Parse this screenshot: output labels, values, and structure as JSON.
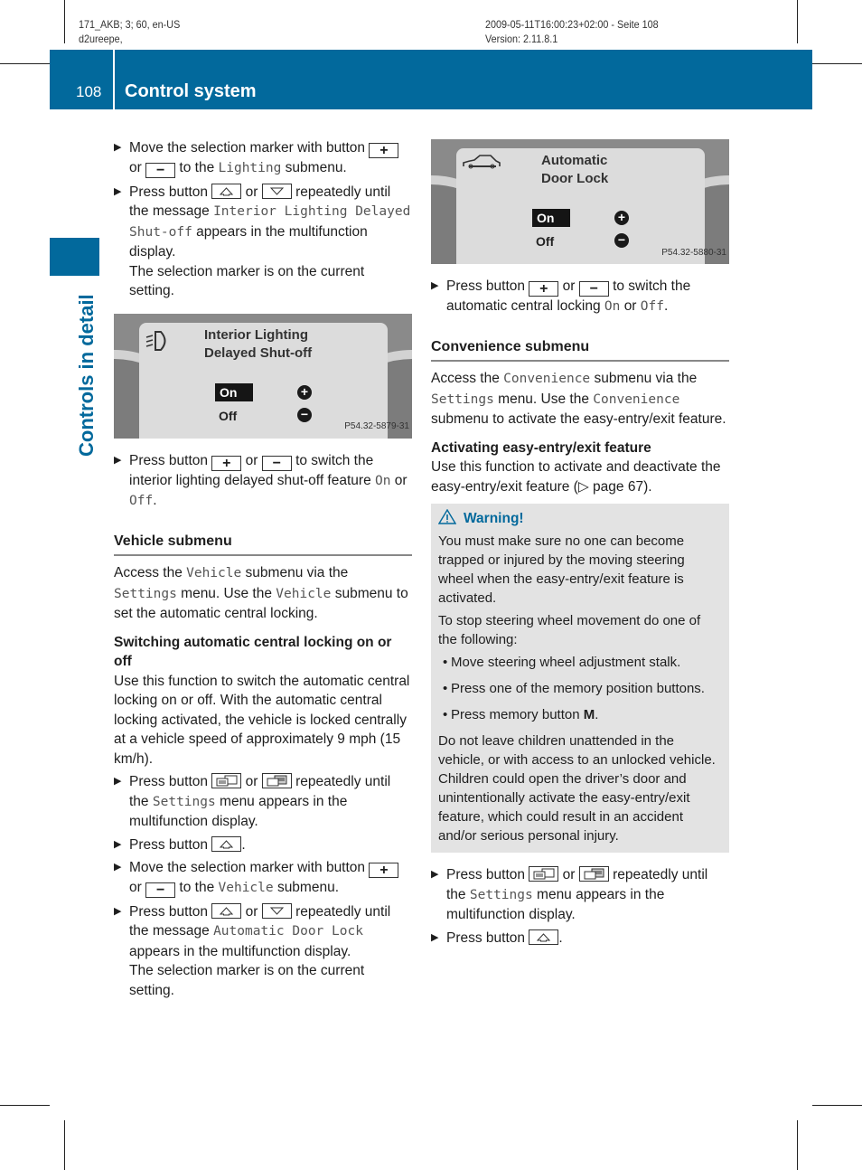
{
  "meta": {
    "top_left_line1": "171_AKB; 3; 60, en-US",
    "top_left_line2": "d2ureepe,",
    "top_right_line1": "2009-05-11T16:00:23+02:00 - Seite 108",
    "top_right_line2": "Version: 2.11.8.1"
  },
  "header": {
    "page_number": "108",
    "title": "Control system",
    "side_label": "Controls in detail",
    "accent_color": "#02699c"
  },
  "left": {
    "step1": {
      "a": "Move the selection marker with button",
      "b": "or",
      "c": "to the",
      "mono": "Lighting",
      "d": "submenu."
    },
    "step2": {
      "a": "Press button",
      "b": "or",
      "c": "repeatedly until the message",
      "mono": "Interior Lighting Delayed Shut-off",
      "d": "appears in the multifunction display.",
      "e": "The selection marker is on the current setting."
    },
    "figure1": {
      "title_line1": "Interior Lighting",
      "title_line2": "Delayed Shut-off",
      "on": "On",
      "off": "Off",
      "code": "P54.32-5879-31"
    },
    "step3": {
      "a": "Press button",
      "b": "or",
      "c": "to switch the interior lighting delayed shut-off feature",
      "on": "On",
      "or": "or",
      "off": "Off",
      "end": "."
    },
    "vehicle_heading": "Vehicle submenu",
    "vehicle_para": {
      "a": "Access the",
      "m1": "Vehicle",
      "b": "submenu via the",
      "m2": "Settings",
      "c": "menu. Use the",
      "m3": "Vehicle",
      "d": "submenu to set the automatic central locking."
    },
    "switching_heading": "Switching automatic central locking on or off",
    "switching_para": "Use this function to switch the automatic central locking on or off. With the automatic central locking activated, the vehicle is locked centrally at a vehicle speed of approximately 9 mph (15 km/h).",
    "step4": {
      "a": "Press button",
      "b": "or",
      "c": "repeatedly until the",
      "mono": "Settings",
      "d": "menu appears in the multifunction display."
    },
    "step5": {
      "a": "Press button",
      "end": "."
    },
    "step6": {
      "a": "Move the selection marker with button",
      "b": "or",
      "c": "to the",
      "mono": "Vehicle",
      "d": "submenu."
    },
    "step7": {
      "a": "Press button",
      "b": "or",
      "c": "repeatedly until the message",
      "mono": "Automatic Door Lock",
      "d": "appears in the multifunction display.",
      "e": "The selection marker is on the current setting."
    }
  },
  "right": {
    "figure2": {
      "title_line1": "Automatic",
      "title_line2": "Door Lock",
      "on": "On",
      "off": "Off",
      "code": "P54.32-5880-31"
    },
    "step1": {
      "a": "Press button",
      "b": "or",
      "c": "to switch the automatic central locking",
      "on": "On",
      "or": "or",
      "off": "Off",
      "end": "."
    },
    "convenience_heading": "Convenience submenu",
    "convenience_para": {
      "a": "Access the",
      "m1": "Convenience",
      "b": "submenu via the",
      "m2": "Settings",
      "c": "menu. Use the",
      "m3": "Convenience",
      "d": "submenu to activate the easy-entry/exit feature."
    },
    "activating_heading": "Activating easy-entry/exit feature",
    "activating_para": "Use this function to activate and deactivate the easy-entry/exit feature (▷ page 67).",
    "warning": {
      "title": "Warning!",
      "p1": "You must make sure no one can become trapped or injured by the moving steering wheel when the easy-entry/exit feature is activated.",
      "p2": "To stop steering wheel movement do one of the following:",
      "bullets": [
        "Move steering wheel adjustment stalk.",
        "Press one of the memory position buttons.",
        "Press memory button"
      ],
      "bullet3_bold": "M",
      "bullet3_end": ".",
      "p3": "Do not leave children unattended in the vehicle, or with access to an unlocked vehicle. Children could open the driver’s door and unintentionally activate the easy-entry/exit feature, which could result in an accident and/or serious personal injury."
    },
    "step2": {
      "a": "Press button",
      "b": "or",
      "c": "repeatedly until the",
      "mono": "Settings",
      "d": "menu appears in the multifunction display."
    },
    "step3": {
      "a": "Press button",
      "end": "."
    }
  }
}
